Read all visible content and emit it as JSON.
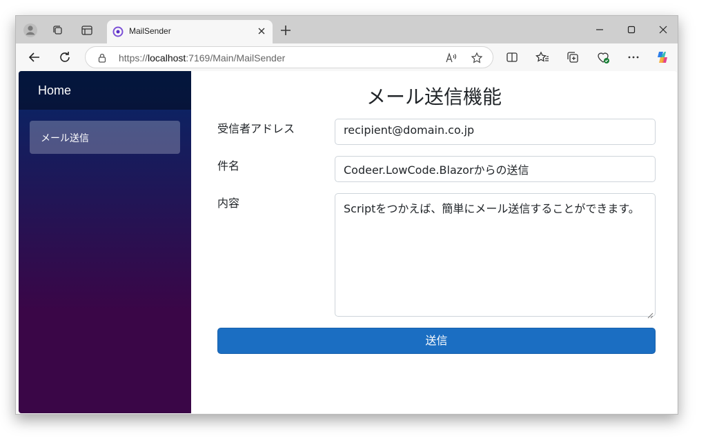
{
  "browser": {
    "tab_title": "MailSender",
    "url_prefix": "https://",
    "url_host": "localhost",
    "url_path": ":7169/Main/MailSender"
  },
  "sidebar": {
    "brand": "Home",
    "items": [
      {
        "label": "メール送信",
        "active": true
      }
    ]
  },
  "main": {
    "title": "メール送信機能",
    "fields": {
      "recipient_label": "受信者アドレス",
      "recipient_value": "recipient@domain.co.jp",
      "subject_label": "件名",
      "subject_value": "Codeer.LowCode.Blazorからの送信",
      "body_label": "内容",
      "body_value": "Scriptをつかえば、簡単にメール送信することができます。"
    },
    "send_label": "送信"
  },
  "colors": {
    "primary_button": "#1b6ec2",
    "sidebar_top": "#052767",
    "sidebar_bottom": "#3a0647"
  }
}
